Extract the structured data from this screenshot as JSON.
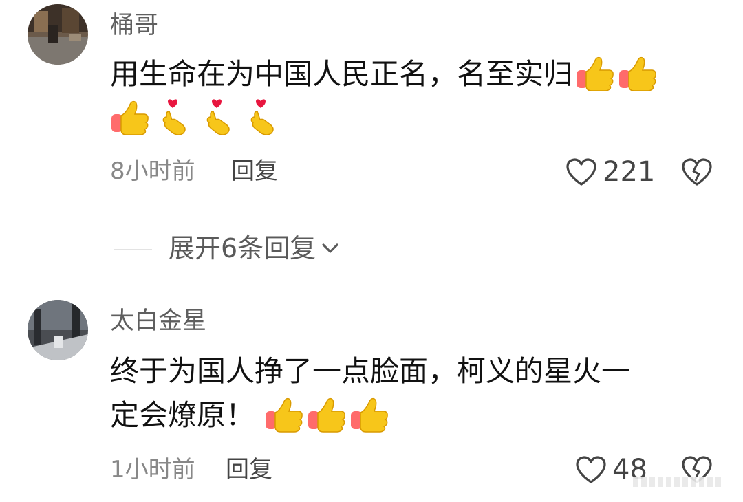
{
  "comments": [
    {
      "username": "桶哥",
      "text": "用生命在为中国人民正名，名至实归",
      "emojis_after_text": [
        "thumbs-up-emoji",
        "thumbs-up-emoji"
      ],
      "emojis_line2": [
        "thumbs-up-emoji",
        "finger-heart-emoji",
        "finger-heart-emoji",
        "finger-heart-emoji"
      ],
      "time": "8小时前",
      "reply_label": "回复",
      "like_count": "221"
    },
    {
      "username": "太白金星",
      "text_line1": "终于为国人挣了一点脸面，柯义的星火一",
      "text_line2": "定会燎原！",
      "emojis_line2": [
        "thumbs-up-emoji",
        "thumbs-up-emoji",
        "thumbs-up-emoji"
      ],
      "time": "1小时前",
      "reply_label": "回复",
      "like_count": "48"
    }
  ],
  "expand_replies": {
    "label": "展开6条回复"
  },
  "colors": {
    "username": "#5f5f5f",
    "text": "#111111",
    "meta": "#888888",
    "emoji_yellow": "#f7c61a",
    "emoji_sleeve": "#ff6b6b",
    "heart_red": "#e8163f"
  }
}
